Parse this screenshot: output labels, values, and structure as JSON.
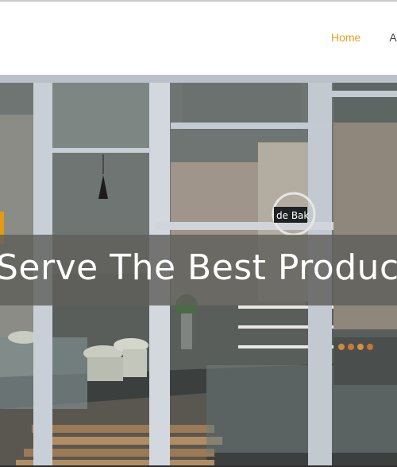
{
  "nav": {
    "items": [
      {
        "label": "Home",
        "active": true
      },
      {
        "label": "A",
        "active": false
      }
    ]
  },
  "hero": {
    "headline": "Serve The Best Product",
    "storefront_sign": "de Bak"
  },
  "colors": {
    "accent": "#e8a017",
    "banner_overlay": "#5f5f5a"
  }
}
